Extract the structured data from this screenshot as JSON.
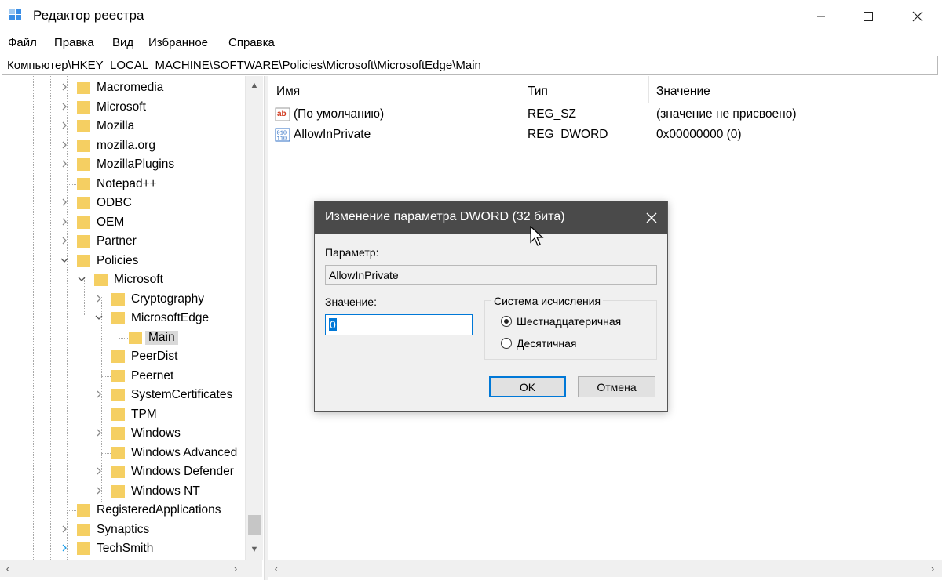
{
  "window": {
    "title": "Редактор реестра",
    "icon": "registry-editor-icon"
  },
  "menu": {
    "items": [
      "Файл",
      "Правка",
      "Вид",
      "Избранное",
      "Справка"
    ]
  },
  "address": {
    "path": "Компьютер\\HKEY_LOCAL_MACHINE\\SOFTWARE\\Policies\\Microsoft\\MicrosoftEdge\\Main"
  },
  "tree": {
    "items": [
      {
        "label": "Macromedia",
        "level": 0,
        "expander": "collapsed"
      },
      {
        "label": "Microsoft",
        "level": 0,
        "expander": "collapsed"
      },
      {
        "label": "Mozilla",
        "level": 0,
        "expander": "collapsed"
      },
      {
        "label": "mozilla.org",
        "level": 0,
        "expander": "collapsed"
      },
      {
        "label": "MozillaPlugins",
        "level": 0,
        "expander": "collapsed"
      },
      {
        "label": "Notepad++",
        "level": 0,
        "expander": "none"
      },
      {
        "label": "ODBC",
        "level": 0,
        "expander": "collapsed"
      },
      {
        "label": "OEM",
        "level": 0,
        "expander": "collapsed"
      },
      {
        "label": "Partner",
        "level": 0,
        "expander": "collapsed"
      },
      {
        "label": "Policies",
        "level": 0,
        "expander": "expanded"
      },
      {
        "label": "Microsoft",
        "level": 1,
        "expander": "expanded"
      },
      {
        "label": "Cryptography",
        "level": 2,
        "expander": "collapsed"
      },
      {
        "label": "MicrosoftEdge",
        "level": 2,
        "expander": "expanded"
      },
      {
        "label": "Main",
        "level": 3,
        "expander": "none",
        "selected": true
      },
      {
        "label": "PeerDist",
        "level": 2,
        "expander": "none"
      },
      {
        "label": "Peernet",
        "level": 2,
        "expander": "none"
      },
      {
        "label": "SystemCertificates",
        "level": 2,
        "expander": "collapsed"
      },
      {
        "label": "TPM",
        "level": 2,
        "expander": "none"
      },
      {
        "label": "Windows",
        "level": 2,
        "expander": "collapsed"
      },
      {
        "label": "Windows Advanced",
        "level": 2,
        "expander": "none"
      },
      {
        "label": "Windows Defender",
        "level": 2,
        "expander": "collapsed"
      },
      {
        "label": "Windows NT",
        "level": 2,
        "expander": "collapsed"
      },
      {
        "label": "RegisteredApplications",
        "level": 0,
        "expander": "none"
      },
      {
        "label": "Synaptics",
        "level": 0,
        "expander": "collapsed"
      },
      {
        "label": "TechSmith",
        "level": 0,
        "expander": "collapsed-highlight"
      }
    ]
  },
  "list": {
    "columns": [
      "Имя",
      "Тип",
      "Значение"
    ],
    "rows": [
      {
        "icon": "string-value-icon",
        "name": "(По умолчанию)",
        "type": "REG_SZ",
        "data": "(значение не присвоено)"
      },
      {
        "icon": "binary-value-icon",
        "name": "AllowInPrivate",
        "type": "REG_DWORD",
        "data": "0x00000000 (0)"
      }
    ]
  },
  "dialog": {
    "title": "Изменение параметра DWORD (32 бита)",
    "param_label": "Параметр:",
    "param_value": "AllowInPrivate",
    "value_label": "Значение:",
    "value_input": "0",
    "base_group": "Система исчисления",
    "radio_hex": "Шестнадцатеричная",
    "radio_dec": "Десятичная",
    "selected_base": "hex",
    "ok": "OK",
    "cancel": "Отмена"
  },
  "colors": {
    "folder": "#f5cf62",
    "dialog_title_bg": "#4a4a4a",
    "accent": "#0078d7"
  }
}
